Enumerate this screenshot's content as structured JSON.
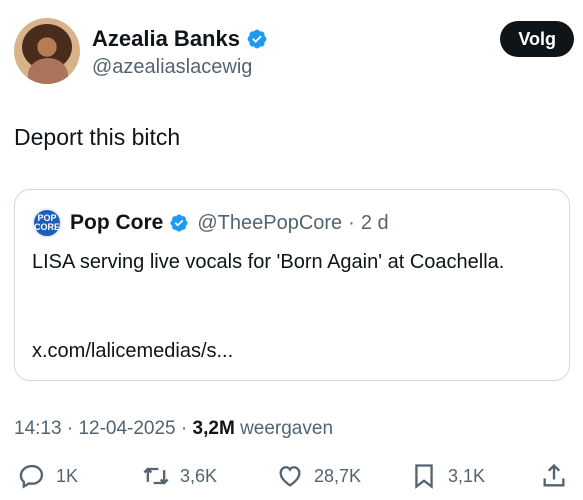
{
  "author": {
    "display_name": "Azealia Banks",
    "handle": "@azealiaslacewig",
    "follow_label": "Volg"
  },
  "tweet": {
    "text": "Deport this bitch"
  },
  "quote": {
    "logo_text_top": "POP",
    "logo_text_bottom": "CORE",
    "display_name": "Pop Core",
    "handle": "@TheePopCore",
    "separator": "·",
    "age": "2 d",
    "body": "LISA serving live vocals for 'Born Again' at Coachella.",
    "link": "x.com/lalicemedias/s..."
  },
  "meta": {
    "time": "14:13",
    "sep1": "·",
    "date": "12-04-2025",
    "sep2": "·",
    "views_count": "3,2M",
    "views_label": "weergaven"
  },
  "actions": {
    "replies": "1K",
    "reposts": "3,6K",
    "likes": "28,7K",
    "bookmarks": "3,1K"
  },
  "colors": {
    "verified": "#1d9bf0",
    "secondary_text": "#536471",
    "primary_text": "#0f1419",
    "border": "#cfd9de"
  },
  "icons": [
    "verified-badge-icon",
    "reply-icon",
    "repost-icon",
    "like-icon",
    "bookmark-icon",
    "share-icon"
  ]
}
